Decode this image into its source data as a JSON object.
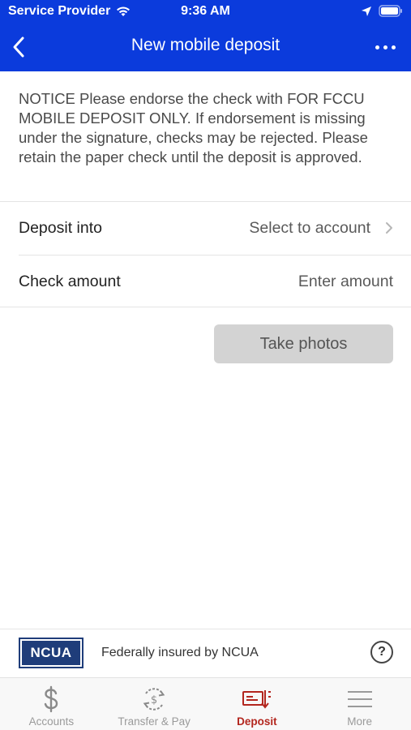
{
  "status_bar": {
    "carrier": "Service Provider",
    "time": "9:36 AM",
    "wifi_icon": "wifi-icon",
    "location_icon": "location-icon",
    "battery_icon": "battery-icon"
  },
  "nav": {
    "title": "New mobile deposit",
    "back_icon": "chevron-left-icon",
    "more_icon": "ellipsis-icon"
  },
  "notice": "NOTICE Please endorse the check with FOR FCCU MOBILE DEPOSIT ONLY. If endorsement is missing under the signature, checks may be rejected. Please retain the paper check until the deposit is approved.",
  "form": {
    "deposit_into_label": "Deposit into",
    "deposit_into_value": "Select to account",
    "check_amount_label": "Check amount",
    "check_amount_placeholder": "Enter amount"
  },
  "take_photos_label": "Take photos",
  "ncua": {
    "logo_text": "NCUA",
    "text": "Federally insured by NCUA",
    "help_label": "?"
  },
  "tabs": [
    {
      "label": "Accounts",
      "icon": "dollar-icon",
      "active": false
    },
    {
      "label": "Transfer & Pay",
      "icon": "transfer-icon",
      "active": false
    },
    {
      "label": "Deposit",
      "icon": "deposit-check-icon",
      "active": true
    },
    {
      "label": "More",
      "icon": "menu-icon",
      "active": false
    }
  ],
  "colors": {
    "header": "#0b3bdc",
    "active_tab": "#b3261e",
    "ncua_blue": "#1f3d7a"
  }
}
